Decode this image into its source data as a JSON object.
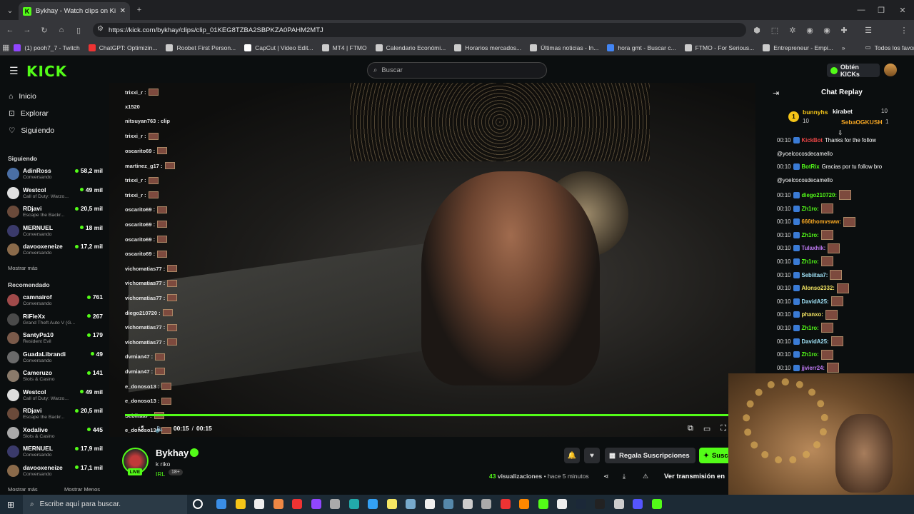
{
  "browser": {
    "tab_title": "Bykhay - Watch clips on Kick",
    "url": "https://kick.com/bykhay/clips/clip_01KEG8TZBA2SBPKZA0PAHM2MTJ",
    "bookmarks": [
      "(1) pooh7_7 - Twitch",
      "ChatGPT: Optimizin...",
      "Roobet First Person...",
      "CapCut | Video Edit...",
      "MT4 | FTMO",
      "Calendario Económi...",
      "Horarios mercados...",
      "Últimas noticias - In...",
      "hora gmt - Buscar c...",
      "FTMO - For Serious...",
      "Entrepreneur - Empi..."
    ],
    "all_bookmarks": "Todos los favoritos"
  },
  "header": {
    "logo": "KICK",
    "search_placeholder": "Buscar",
    "kicks_label": "Obtén KICKs"
  },
  "nav": {
    "home": "Inicio",
    "explore": "Explorar",
    "following": "Siguiendo"
  },
  "sidebar": {
    "following_header": "Siguiendo",
    "following": [
      {
        "name": "AdinRoss",
        "cat": "Conversando",
        "viewers": "58,2 mil"
      },
      {
        "name": "Westcol",
        "cat": "Call of Duty: Warzo...",
        "viewers": "49 mil"
      },
      {
        "name": "RDjavi",
        "cat": "Escape the Backr...",
        "viewers": "20,5 mil"
      },
      {
        "name": "MERNUEL",
        "cat": "Conversando",
        "viewers": "18 mil"
      },
      {
        "name": "davooxeneize",
        "cat": "Conversando",
        "viewers": "17,2 mil"
      }
    ],
    "show_more": "Mostrar más",
    "recommended_header": "Recomendado",
    "recommended": [
      {
        "name": "camnairof",
        "cat": "Conversando",
        "viewers": "761"
      },
      {
        "name": "RiFleXx",
        "cat": "Grand Theft Auto V (G...",
        "viewers": "267"
      },
      {
        "name": "SantyPa10",
        "cat": "Resident Evil",
        "viewers": "179"
      },
      {
        "name": "GuadaLibrandi",
        "cat": "Conversando",
        "viewers": "49"
      },
      {
        "name": "Cameruzo",
        "cat": "Slots & Casino",
        "viewers": "141"
      },
      {
        "name": "Westcol",
        "cat": "Call of Duty: Warzo...",
        "viewers": "49 mil"
      },
      {
        "name": "RDjavi",
        "cat": "Escape the Backr...",
        "viewers": "20,5 mil"
      },
      {
        "name": "Xodalive",
        "cat": "Slots & Casino",
        "viewers": "445"
      },
      {
        "name": "MERNUEL",
        "cat": "Conversando",
        "viewers": "17,9 mil"
      },
      {
        "name": "davooxeneize",
        "cat": "Conversando",
        "viewers": "17,1 mil"
      }
    ],
    "show_more2": "Mostrar más",
    "show_less": "Mostrar Menos"
  },
  "overlay_chat": [
    "trixxi_r :",
    "x1520",
    "nitsuyan763 : clip",
    "trixxi_r :",
    "oscarito69 :",
    "martinez_g17 :",
    "trixxi_r :",
    "trixxi_r :",
    "oscarito69 :",
    "oscarito69 :",
    "oscarito69 :",
    "oscarito69 :",
    "vichomatias77 :",
    "vichomatias77 :",
    "vichomatias77 :",
    "diego210720 :",
    "vichomatias77 :",
    "vichomatias77 :",
    "dvmian47 :",
    "dvmian47 :",
    "e_donoso13 :",
    "e_donoso13 :",
    "Sebiitaa7 :",
    "e_donoso13 :"
  ],
  "player": {
    "time_current": "00:15",
    "time_sep": "/",
    "time_total": "00:15",
    "progress": 1.0
  },
  "channel": {
    "name": "Bykhay",
    "live": "LIVE",
    "title": "k riko",
    "category": "IRL",
    "age": "18+",
    "views_count": "43",
    "views_label": "visualizaciones",
    "ago": "• hace 5 minutos",
    "gift_label": "Regala Suscripciones",
    "sub_label": "Suscr",
    "watch_label": "Ver transmisión en"
  },
  "chat": {
    "title": "Chat Replay",
    "top_gifter": {
      "rank": "1",
      "name": "bunnyhs",
      "count": "10"
    },
    "gifters": [
      {
        "name": "kirabet",
        "count": "10"
      },
      {
        "name": "SebaOGKUSH",
        "count": "1"
      }
    ],
    "messages": [
      {
        "t": "00:10",
        "user": "KickBot",
        "msg": "Thanks for the follow",
        "color": "#e84545"
      },
      {
        "t": "",
        "user": "",
        "msg": "@yoelcocosdecamello",
        "color": "#fff"
      },
      {
        "t": "00:10",
        "user": "BotRix",
        "msg": "Gracias por tu follow bro",
        "color": "#53fc18"
      },
      {
        "t": "",
        "user": "",
        "msg": "@yoelcocosdecamello",
        "color": "#fff"
      },
      {
        "t": "00:10",
        "user": "diego210720:",
        "msg": "",
        "color": "#53fc18"
      },
      {
        "t": "00:10",
        "user": "Zh1ro:",
        "msg": "",
        "color": "#53fc18"
      },
      {
        "t": "00:10",
        "user": "666thomvsww:",
        "msg": "",
        "color": "#f5a623"
      },
      {
        "t": "00:10",
        "user": "Zh1ro:",
        "msg": "",
        "color": "#53fc18"
      },
      {
        "t": "00:10",
        "user": "Tulaxhik:",
        "msg": "",
        "color": "#c07af5"
      },
      {
        "t": "00:10",
        "user": "Zh1ro:",
        "msg": "",
        "color": "#53fc18"
      },
      {
        "t": "00:10",
        "user": "Sebiitaa7:",
        "msg": "",
        "color": "#9fe0f5"
      },
      {
        "t": "00:10",
        "user": "Alonso2332:",
        "msg": "",
        "color": "#f5e663"
      },
      {
        "t": "00:10",
        "user": "DavidA25:",
        "msg": "",
        "color": "#9fe0f5"
      },
      {
        "t": "00:10",
        "user": "phanxo:",
        "msg": "",
        "color": "#f5e663"
      },
      {
        "t": "00:10",
        "user": "Zh1ro:",
        "msg": "",
        "color": "#53fc18"
      },
      {
        "t": "00:10",
        "user": "DavidA25:",
        "msg": "",
        "color": "#9fe0f5"
      },
      {
        "t": "00:10",
        "user": "Zh1ro:",
        "msg": "",
        "color": "#53fc18"
      },
      {
        "t": "00:10",
        "user": "jjvierr24:",
        "msg": "",
        "color": "#c07af5"
      },
      {
        "t": "00:10",
        "user": "Sebiitaa7:",
        "msg": "",
        "color": "#9fe0f5"
      }
    ]
  },
  "taskbar": {
    "search_placeholder": "Escribe aquí para buscar."
  },
  "colors": {
    "accent": "#53fc18"
  }
}
